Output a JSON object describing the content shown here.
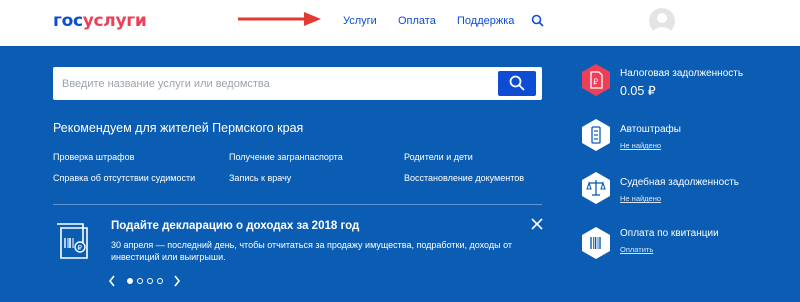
{
  "header": {
    "logo_part1": "гос",
    "logo_part2": "услуги",
    "nav": [
      "Услуги",
      "Оплата",
      "Поддержка"
    ],
    "search_icon": "search-icon",
    "avatar": "user-avatar-icon",
    "brand_colors": {
      "blue": "#0d4cd3",
      "red": "#ee3f58",
      "arrow": "#e53935"
    }
  },
  "main": {
    "search": {
      "placeholder": "Введите название услуги или ведомства",
      "button_icon": "search-icon"
    },
    "recommended": {
      "title": "Рекомендуем для жителей Пермского края",
      "links": [
        "Проверка штрафов",
        "Получение загранпаспорта",
        "Родители и дети",
        "Справка об отсутствии судимости",
        "Запись к врачу",
        "Восстановление документов"
      ]
    },
    "promo": {
      "title": "Подайте декларацию о доходах за 2018 год",
      "text": "30 апреля — последний день, чтобы отчитаться за продажу имущества, подработки, доходы от инвестиций или выигрыши.",
      "icon": "tax-declaration-icon",
      "close_icon": "close-icon",
      "pager": {
        "total": 4,
        "active": 1
      }
    },
    "background_color": "#0b5db4"
  },
  "widgets": [
    {
      "title": "Налоговая задолженность",
      "amount": "0.05 ₽",
      "icon": "tax-debt-icon",
      "icon_color": "#ee3f58"
    },
    {
      "title": "Автоштрафы",
      "sub": "Не найдено",
      "icon": "car-fine-icon",
      "icon_color": "#ffffff"
    },
    {
      "title": "Судебная задолженность",
      "sub": "Не найдено",
      "icon": "scales-icon",
      "icon_color": "#ffffff"
    },
    {
      "title": "Оплата по квитанции",
      "sub": "Оплатить",
      "icon": "barcode-icon",
      "icon_color": "#ffffff"
    }
  ]
}
